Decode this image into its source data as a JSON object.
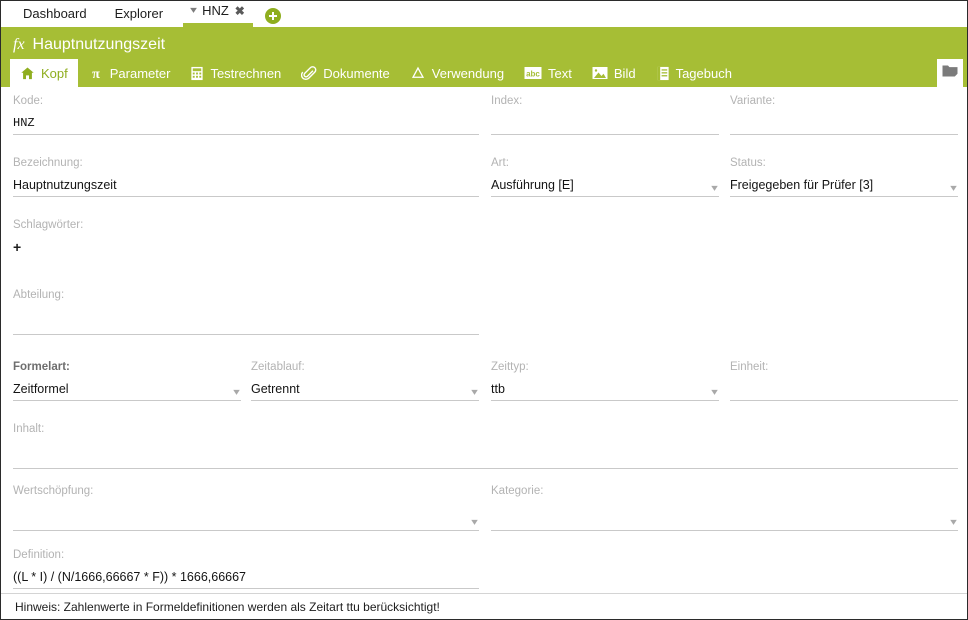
{
  "topnav": {
    "items": [
      {
        "label": "Dashboard",
        "icon": "none"
      },
      {
        "label": "Explorer",
        "icon": "none"
      }
    ],
    "active_tab": {
      "label": "HNZ",
      "chevron_icon": "chevron-down-icon",
      "close_icon": "close-icon"
    },
    "add_button_icon": "plus-circle-icon"
  },
  "header": {
    "icon": "fx",
    "title": "Hauptnutzungszeit",
    "accent_color": "#a6be35",
    "corner_button_icon": "note-folder-icon"
  },
  "tabs": [
    {
      "label": "Kopf",
      "icon": "home-icon",
      "active": true
    },
    {
      "label": "Parameter",
      "icon": "pi-icon",
      "active": false
    },
    {
      "label": "Testrechnen",
      "icon": "calculator-icon",
      "active": false
    },
    {
      "label": "Dokumente",
      "icon": "paperclip-icon",
      "active": false
    },
    {
      "label": "Verwendung",
      "icon": "recycle-icon",
      "active": false
    },
    {
      "label": "Text",
      "icon": "abc-icon",
      "active": false
    },
    {
      "label": "Bild",
      "icon": "image-icon",
      "active": false
    },
    {
      "label": "Tagebuch",
      "icon": "journal-icon",
      "active": false
    }
  ],
  "fields": {
    "kode": {
      "label": "Kode:",
      "value": "HNZ"
    },
    "index": {
      "label": "Index:",
      "value": ""
    },
    "variante": {
      "label": "Variante:",
      "value": ""
    },
    "bezeichnung": {
      "label": "Bezeichnung:",
      "value": "Hauptnutzungszeit"
    },
    "art": {
      "label": "Art:",
      "value": "Ausführung [E]"
    },
    "status": {
      "label": "Status:",
      "value": "Freigegeben für Prüfer [3]"
    },
    "schlagwoerter": {
      "label": "Schlagwörter:",
      "value": "",
      "add_label": "+"
    },
    "abteilung": {
      "label": "Abteilung:",
      "value": ""
    },
    "formelart": {
      "label": "Formelart:",
      "value": "Zeitformel"
    },
    "zeitablauf": {
      "label": "Zeitablauf:",
      "value": "Getrennt"
    },
    "zeittyp": {
      "label": "Zeittyp:",
      "value": "ttb"
    },
    "einheit": {
      "label": "Einheit:",
      "value": ""
    },
    "inhalt": {
      "label": "Inhalt:",
      "value": ""
    },
    "wertschoepfung": {
      "label": "Wertschöpfung:",
      "value": ""
    },
    "kategorie": {
      "label": "Kategorie:",
      "value": ""
    },
    "definition": {
      "label": "Definition:",
      "value": "((L * I) / (N/1666,66667 * F)) * 1666,66667"
    }
  },
  "footer": {
    "note": "Hinweis: Zahlenwerte in Formeldefinitionen werden als Zeitart ttu berücksichtigt!"
  }
}
